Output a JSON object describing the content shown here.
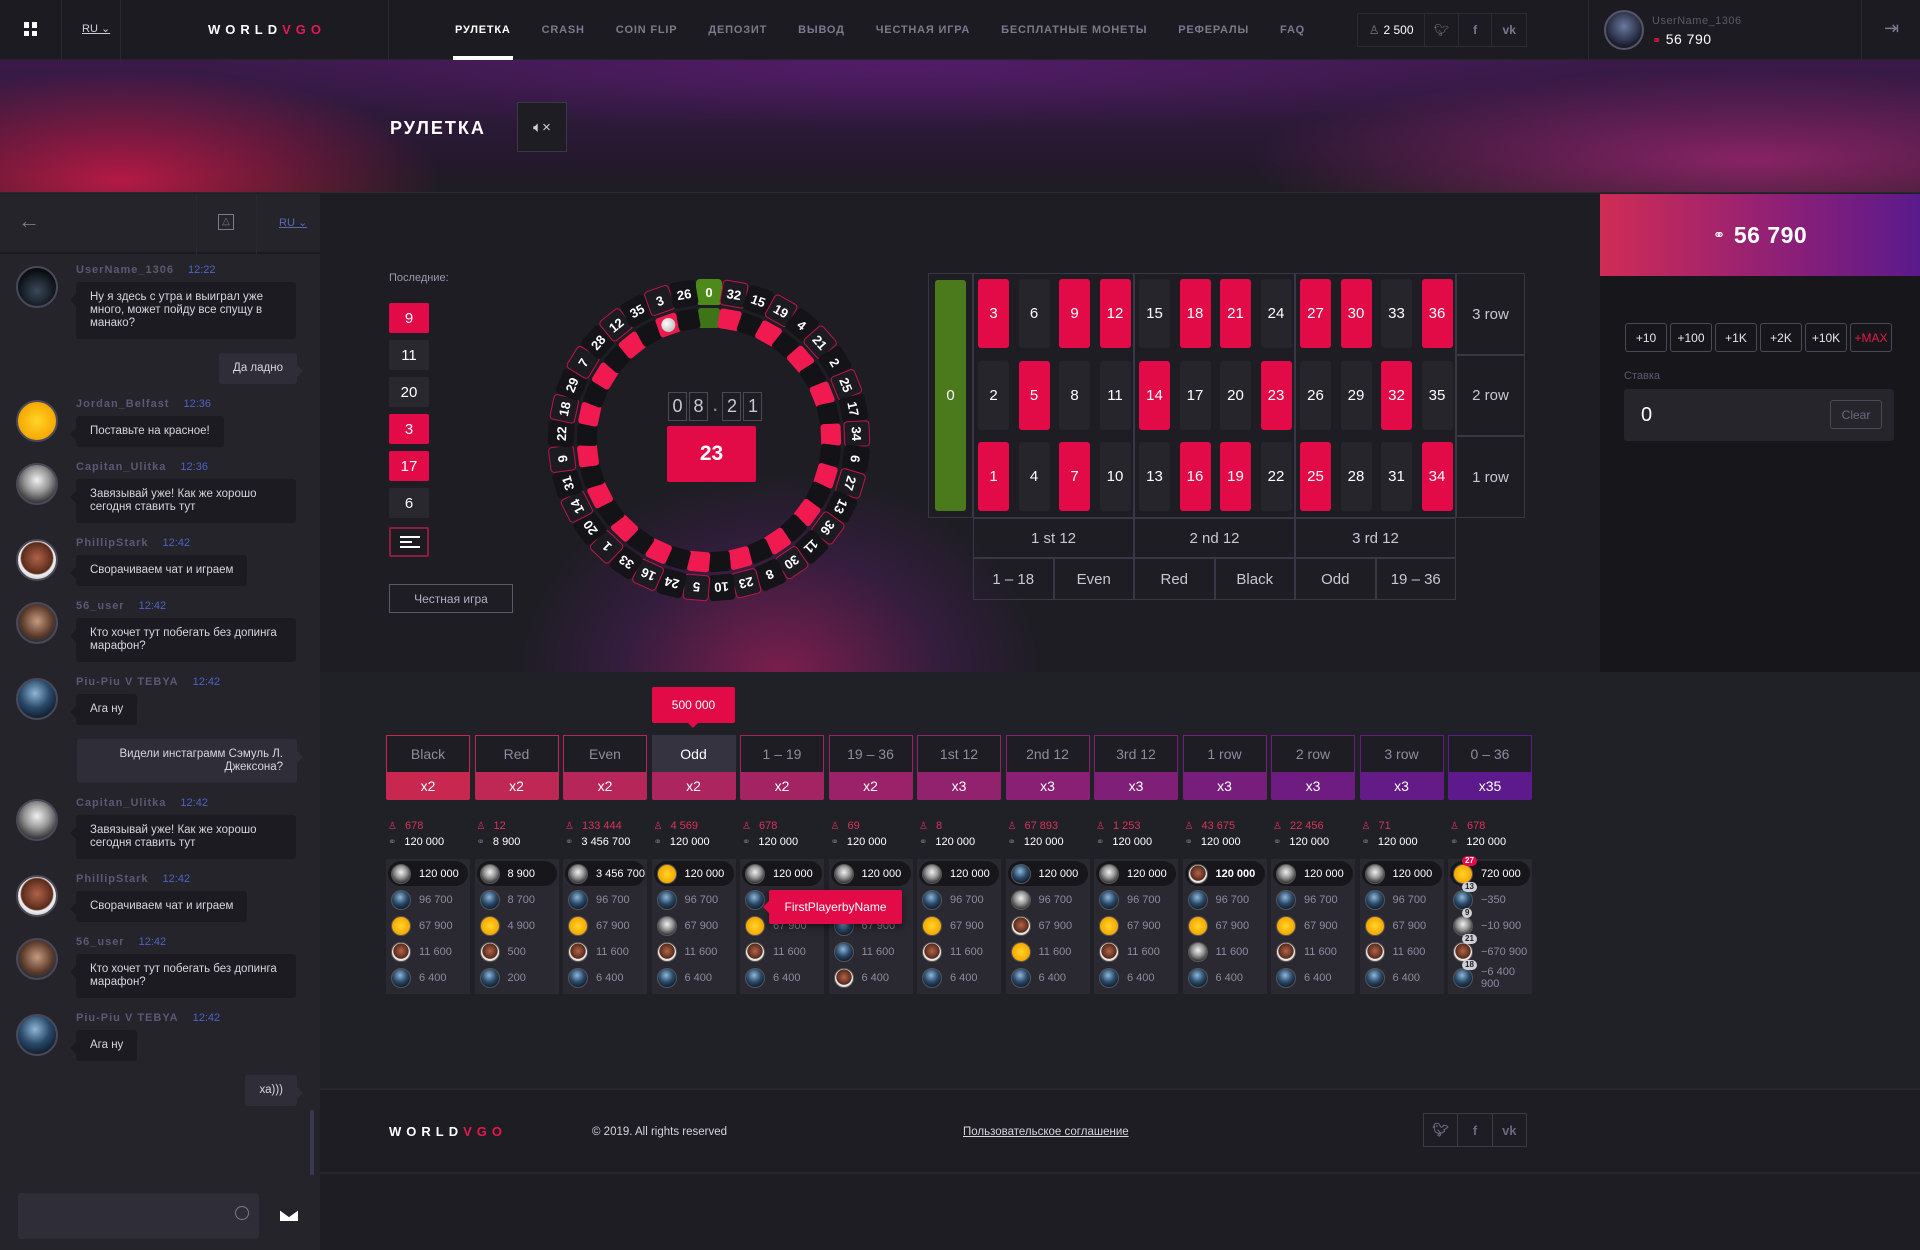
{
  "header": {
    "lang": "RU",
    "logo": {
      "a": "WORLD",
      "b": "VGO"
    },
    "nav": [
      "РУЛЕТКА",
      "CRASH",
      "COIN FLIP",
      "ДЕПОЗИТ",
      "ВЫВОД",
      "ЧЕСТНАЯ ИГРА",
      "БЕСПЛАТНЫЕ МОНЕТЫ",
      "РЕФЕРАЛЫ",
      "FAQ"
    ],
    "active_nav": "РУЛЕТКА",
    "online": "2 500",
    "social": [
      "twitter-icon",
      "facebook-icon",
      "vk-icon"
    ],
    "user": {
      "name": "UserName_1306",
      "balance": "56 790"
    }
  },
  "page": {
    "title": "РУЛЕТКА"
  },
  "chat": {
    "lang": "RU",
    "messages": [
      {
        "user": "UserName_1306",
        "time": "12:22",
        "avatar": "mask",
        "text": "Ну я здесь с утра и выиграл уже много, может пойду все спущу в манако?"
      },
      {
        "own": true,
        "text": "Да ладно"
      },
      {
        "user": "Jordan_Belfast",
        "time": "12:36",
        "avatar": "emoji",
        "text": "Поставьте на красное!"
      },
      {
        "user": "Capitan_Ulitka",
        "time": "12:36",
        "avatar": "woman",
        "text": "Завязывай уже! Как же хорошо сегодня ставить тут"
      },
      {
        "user": "PhillipStark",
        "time": "12:42",
        "avatar": "bald",
        "text": "Сворачиваем чат и играем"
      },
      {
        "user": "56_user",
        "time": "12:42",
        "avatar": "beard",
        "text": "Кто хочет тут  побегать без допинга марафон?"
      },
      {
        "user": "Piu-Piu V TEBYA",
        "time": "12:42",
        "avatar": "robot",
        "text": "Ага ну"
      },
      {
        "own": true,
        "text": "Видели инстаграмм Сэмуль Л. Джексона?"
      },
      {
        "user": "Capitan_Ulitka",
        "time": "12:42",
        "avatar": "woman",
        "text": "Завязывай уже! Как же хорошо сегодня ставить тут"
      },
      {
        "user": "PhillipStark",
        "time": "12:42",
        "avatar": "bald",
        "text": "Сворачиваем чат и играем"
      },
      {
        "user": "56_user",
        "time": "12:42",
        "avatar": "beard",
        "text": "Кто хочет тут  побегать без допинга марафон?"
      },
      {
        "user": "Piu-Piu V TEBYA",
        "time": "12:42",
        "avatar": "robot",
        "text": "Ага ну"
      },
      {
        "own": true,
        "text": "ха)))"
      }
    ],
    "input_value": ""
  },
  "game": {
    "recent_label": "Последние:",
    "recent": [
      {
        "n": "9",
        "c": "red"
      },
      {
        "n": "11",
        "c": "black"
      },
      {
        "n": "20",
        "c": "black"
      },
      {
        "n": "3",
        "c": "red"
      },
      {
        "n": "17",
        "c": "red"
      },
      {
        "n": "6",
        "c": "black"
      }
    ],
    "fair_label": "Честная игра",
    "timer": [
      "0",
      "8",
      "2",
      "1"
    ],
    "result": "23",
    "wheel": [
      0,
      32,
      15,
      19,
      4,
      21,
      2,
      25,
      17,
      34,
      6,
      27,
      13,
      36,
      11,
      30,
      8,
      23,
      10,
      5,
      24,
      16,
      33,
      1,
      20,
      14,
      31,
      9,
      22,
      18,
      29,
      7,
      28,
      12,
      35,
      3,
      26
    ],
    "ball_on": 3,
    "red_numbers": [
      1,
      3,
      5,
      7,
      9,
      12,
      14,
      16,
      18,
      19,
      21,
      23,
      25,
      27,
      30,
      32,
      34,
      36
    ],
    "colors": {
      "red": "#e30b47",
      "black": "#26252c",
      "green": "#4d8a1a"
    }
  },
  "board": {
    "zero": "0",
    "rows": [
      {
        "label": "3 row",
        "nums": [
          3,
          6,
          9,
          12,
          15,
          18,
          21,
          24,
          27,
          30,
          33,
          36
        ]
      },
      {
        "label": "2 row",
        "nums": [
          2,
          5,
          8,
          11,
          14,
          17,
          20,
          23,
          26,
          29,
          32,
          35
        ]
      },
      {
        "label": "1 row",
        "nums": [
          1,
          4,
          7,
          10,
          13,
          16,
          19,
          22,
          25,
          28,
          31,
          34
        ]
      }
    ],
    "dozens": [
      "1 st 12",
      "2 nd 12",
      "3 rd 12"
    ],
    "outside": [
      "1 – 18",
      "Even",
      "Red",
      "Black",
      "Odd",
      "19 – 36"
    ]
  },
  "panel": {
    "balance": "56 790",
    "chips": [
      "+10",
      "+100",
      "+1K",
      "+2K",
      "+10K",
      "+MAX"
    ],
    "stake_label": "Ставка",
    "stake_value": "0",
    "clear_label": "Clear"
  },
  "bets": {
    "tooltip_bet": "500 000",
    "tooltip_player": "FirstPlayerbyName",
    "columns": [
      {
        "label": "Black",
        "mult": "x2",
        "count": "678",
        "total": "120 000",
        "players": [
          [
            "woman",
            "120 000"
          ],
          [
            "robot",
            "96 700"
          ],
          [
            "emoji",
            "67 900"
          ],
          [
            "bald",
            "11 600"
          ],
          [
            "robot",
            "6 400"
          ]
        ]
      },
      {
        "label": "Red",
        "mult": "x2",
        "count": "12",
        "total": "8 900",
        "players": [
          [
            "woman",
            "8 900"
          ],
          [
            "robot",
            "8 700"
          ],
          [
            "emoji",
            "4 900"
          ],
          [
            "bald",
            "500"
          ],
          [
            "robot",
            "200"
          ]
        ]
      },
      {
        "label": "Even",
        "mult": "x2",
        "count": "133 444",
        "total": "3 456 700",
        "players": [
          [
            "woman",
            "3 456 700"
          ],
          [
            "robot",
            "96 700"
          ],
          [
            "emoji",
            "67 900"
          ],
          [
            "bald",
            "11 600"
          ],
          [
            "robot",
            "6 400"
          ]
        ]
      },
      {
        "label": "Odd",
        "mult": "x2",
        "count": "4 569",
        "total": "120 000",
        "selected": true,
        "players": [
          [
            "emoji",
            "120 000"
          ],
          [
            "robot",
            "96 700"
          ],
          [
            "woman",
            "67 900"
          ],
          [
            "bald",
            "11 600"
          ],
          [
            "robot",
            "6 400"
          ]
        ]
      },
      {
        "label": "1 – 19",
        "mult": "x2",
        "count": "678",
        "total": "120 000",
        "players": [
          [
            "woman",
            "120 000"
          ],
          [
            "robot",
            ""
          ],
          [
            "emoji",
            "67 900"
          ],
          [
            "bald",
            "11 600"
          ],
          [
            "robot",
            "6 400"
          ]
        ]
      },
      {
        "label": "19 – 36",
        "mult": "x2",
        "count": "69",
        "total": "120 000",
        "players": [
          [
            "woman",
            "120 000"
          ],
          [
            "robot",
            ""
          ],
          [
            "robot",
            "67 900"
          ],
          [
            "robot",
            "11 600"
          ],
          [
            "bald",
            "6 400"
          ]
        ]
      },
      {
        "label": "1st 12",
        "mult": "x3",
        "count": "8",
        "total": "120 000",
        "players": [
          [
            "woman",
            "120 000"
          ],
          [
            "robot",
            "96 700"
          ],
          [
            "emoji",
            "67 900"
          ],
          [
            "bald",
            "11 600"
          ],
          [
            "robot",
            "6 400"
          ]
        ]
      },
      {
        "label": "2nd 12",
        "mult": "x3",
        "count": "67 893",
        "total": "120 000",
        "players": [
          [
            "robot",
            "120 000"
          ],
          [
            "woman",
            "96 700"
          ],
          [
            "bald",
            "67 900"
          ],
          [
            "emoji",
            "11 600"
          ],
          [
            "robot",
            "6 400"
          ]
        ]
      },
      {
        "label": "3rd 12",
        "mult": "x3",
        "count": "1 253",
        "total": "120 000",
        "players": [
          [
            "woman",
            "120 000"
          ],
          [
            "robot",
            "96 700"
          ],
          [
            "emoji",
            "67 900"
          ],
          [
            "bald",
            "11 600"
          ],
          [
            "robot",
            "6 400"
          ]
        ]
      },
      {
        "label": "1 row",
        "mult": "x3",
        "count": "43 675",
        "total": "120 000",
        "players": [
          [
            "bald",
            "120 000"
          ],
          [
            "robot",
            "96 700"
          ],
          [
            "emoji",
            "67 900"
          ],
          [
            "woman",
            "11 600"
          ],
          [
            "robot",
            "6 400"
          ]
        ]
      },
      {
        "label": "2 row",
        "mult": "x3",
        "count": "22 456",
        "total": "120 000",
        "players": [
          [
            "woman",
            "120 000"
          ],
          [
            "robot",
            "96 700"
          ],
          [
            "emoji",
            "67 900"
          ],
          [
            "bald",
            "11 600"
          ],
          [
            "robot",
            "6 400"
          ]
        ]
      },
      {
        "label": "3 row",
        "mult": "x3",
        "count": "71",
        "total": "120 000",
        "players": [
          [
            "woman",
            "120 000"
          ],
          [
            "robot",
            "96 700"
          ],
          [
            "emoji",
            "67 900"
          ],
          [
            "bald",
            "11 600"
          ],
          [
            "robot",
            "6 400"
          ]
        ]
      },
      {
        "label": "0 – 36",
        "mult": "x35",
        "count": "678",
        "total": "120 000",
        "players": [
          [
            "emoji",
            "720 000",
            "27"
          ],
          [
            "robot",
            "−350",
            "13"
          ],
          [
            "woman",
            "−10 900",
            "9"
          ],
          [
            "bald",
            "−670 900",
            "21"
          ],
          [
            "robot",
            "−6 400 900",
            "18"
          ]
        ]
      }
    ],
    "gradient": [
      "#c8284f",
      "#5c1a8c"
    ]
  },
  "footer": {
    "logo": {
      "a": "WORLD",
      "b": "VGO"
    },
    "copyright": "© 2019. All rights reserved",
    "agreement": "Пользовательское соглашение",
    "social": [
      "twitter-icon",
      "facebook-icon",
      "vk-icon"
    ]
  }
}
